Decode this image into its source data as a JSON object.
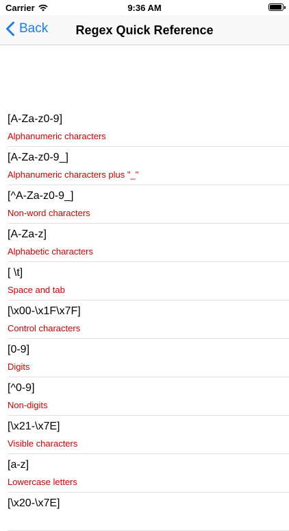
{
  "status_bar": {
    "carrier": "Carrier",
    "time": "9:36 AM"
  },
  "nav": {
    "back_label": "Back",
    "title": "Regex Quick Reference"
  },
  "items": [
    {
      "pattern": "[A-Za-z0-9]",
      "description": "Alphanumeric characters"
    },
    {
      "pattern": "[A-Za-z0-9_]",
      "description": "Alphanumeric characters plus \"_\""
    },
    {
      "pattern": "[^A-Za-z0-9_]",
      "description": "Non-word characters"
    },
    {
      "pattern": "[A-Za-z]",
      "description": "Alphabetic characters"
    },
    {
      "pattern": "[ \\t]",
      "description": "Space and tab"
    },
    {
      "pattern": "[\\x00-\\x1F\\x7F]",
      "description": "Control characters"
    },
    {
      "pattern": "[0-9]",
      "description": "Digits"
    },
    {
      "pattern": "[^0-9]",
      "description": "Non-digits"
    },
    {
      "pattern": "[\\x21-\\x7E]",
      "description": "Visible characters"
    },
    {
      "pattern": "[a-z]",
      "description": "Lowercase letters"
    },
    {
      "pattern": "[\\x20-\\x7E]",
      "description": ""
    }
  ],
  "colors": {
    "accent": "#1a7cf5",
    "description": "#d80000"
  }
}
